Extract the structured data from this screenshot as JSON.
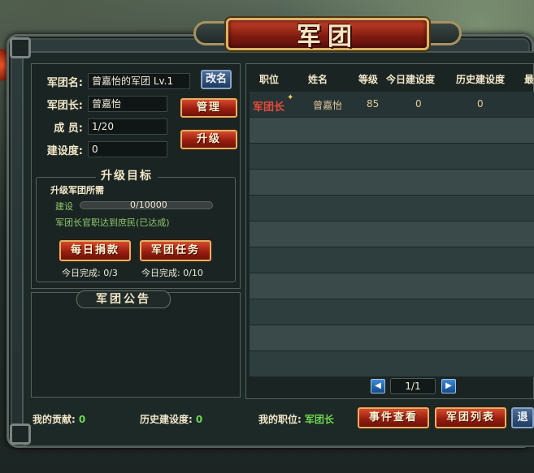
{
  "window": {
    "title": "军团"
  },
  "info": {
    "name_label": "军团名:",
    "name_value": "曾嘉怡的军团 Lv.1",
    "rename_button": "改名",
    "leader_label": "军团长:",
    "leader_value": "曾嘉怡",
    "manage_button": "管理",
    "members_label": "成 员:",
    "members_value": "1/20",
    "upgrade_button": "升级",
    "construction_label": "建设度:",
    "construction_value": "0"
  },
  "upgrade_goal": {
    "title": "升级目标",
    "requirement_heading": "升级军团所需",
    "construction_label": "建设",
    "construction_progress": "0/10000",
    "construction_fraction": 0.0,
    "leader_condition": "军团长官职达到庶民(已达成)",
    "donate_button": "每日捐款",
    "task_button": "军团任务",
    "donate_done": "今日完成: 0/3",
    "task_done": "今日完成: 0/10"
  },
  "notice": {
    "title": "军团公告"
  },
  "table": {
    "headers": [
      "职位",
      "姓名",
      "等级",
      "今日建设度",
      "历史建设度",
      "最"
    ],
    "rows": [
      {
        "position": "军团长",
        "name": "曾嘉怡",
        "level": "85",
        "today": "0",
        "history": "0"
      }
    ],
    "empty_rows": 10,
    "page": "1/1",
    "prev_icon": "triangle-left-icon",
    "next_icon": "triangle-right-icon"
  },
  "footer": {
    "contribution_label": "我的贡献:",
    "contribution_value": "0",
    "history_label": "历史建设度:",
    "history_value": "0",
    "my_position_label": "我的职位:",
    "my_position_value": "军团长",
    "events_button": "事件查看",
    "list_button": "军团列表",
    "quit_button": "退"
  },
  "colors": {
    "accent_red": "#9a1e10",
    "gold_border": "#e0b268",
    "green_value": "#6fd84e",
    "leader_red": "#e84a3a"
  }
}
